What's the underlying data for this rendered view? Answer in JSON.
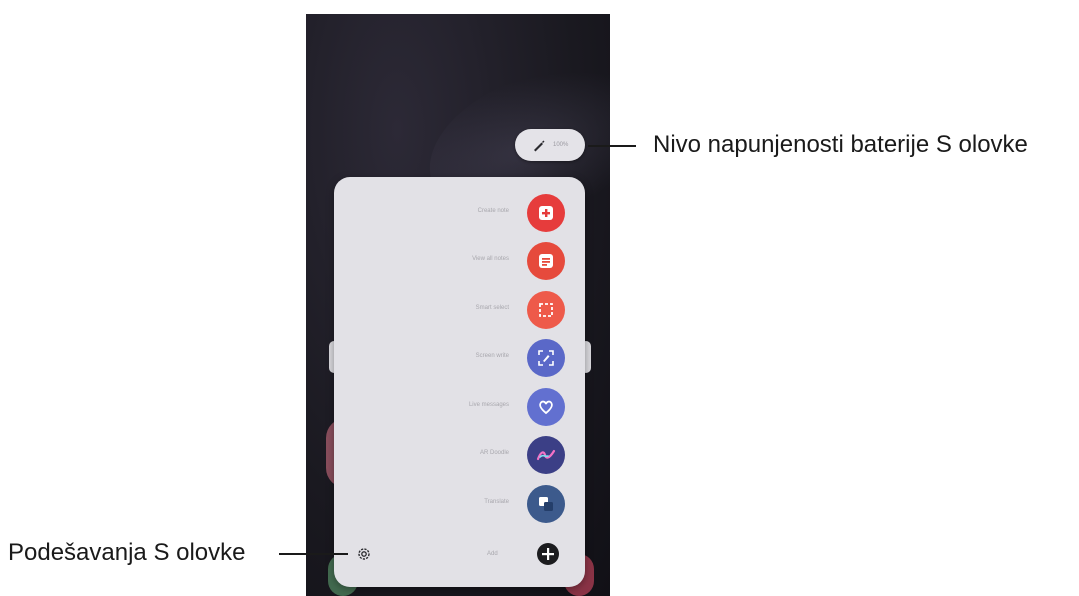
{
  "callouts": {
    "battery_label": "Nivo napunjenosti baterije S olovke",
    "settings_label": "Podešavanja S olovke"
  },
  "battery_pill": {
    "text": "100%"
  },
  "air_command": {
    "items": [
      {
        "label": "Create note",
        "icon": "create-note-icon",
        "color": "#e63c3c"
      },
      {
        "label": "View all notes",
        "icon": "view-notes-icon",
        "color": "#e64a3c"
      },
      {
        "label": "Smart select",
        "icon": "smart-select-icon",
        "color": "#ee5a4a"
      },
      {
        "label": "Screen write",
        "icon": "screen-write-icon",
        "color": "#5a68c8"
      },
      {
        "label": "Live messages",
        "icon": "live-messages-icon",
        "color": "#6270d0"
      },
      {
        "label": "AR Doodle",
        "icon": "ar-doodle-icon",
        "color": "#3b3f86"
      },
      {
        "label": "Translate",
        "icon": "translate-icon",
        "color": "#3c5a8c"
      }
    ],
    "add_label": "Add"
  }
}
